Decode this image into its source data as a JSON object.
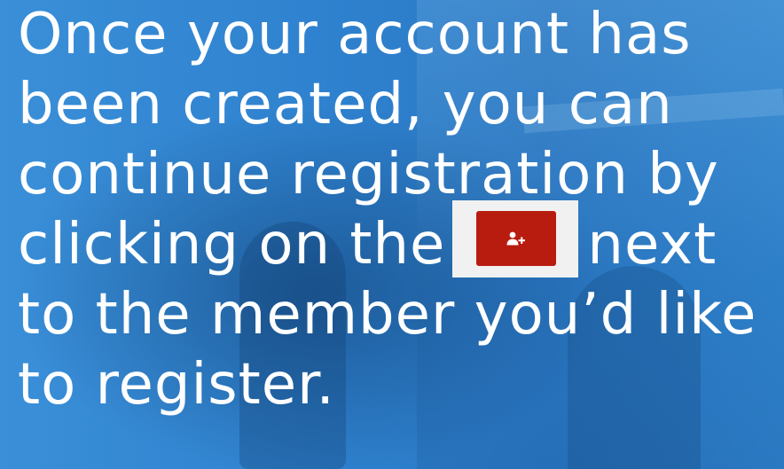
{
  "message": {
    "line1": "Once your account has",
    "line2": "been created, you can",
    "line3": "continue registration by",
    "line4_before": "clicking on the",
    "line4_after": "next",
    "line5": "to the member you’d like",
    "line6": "to register."
  },
  "add_member_button": {
    "icon": "add-user-icon",
    "color": "#b71c0f"
  },
  "colors": {
    "background": "#2f82cf",
    "text": "#ffffff"
  }
}
